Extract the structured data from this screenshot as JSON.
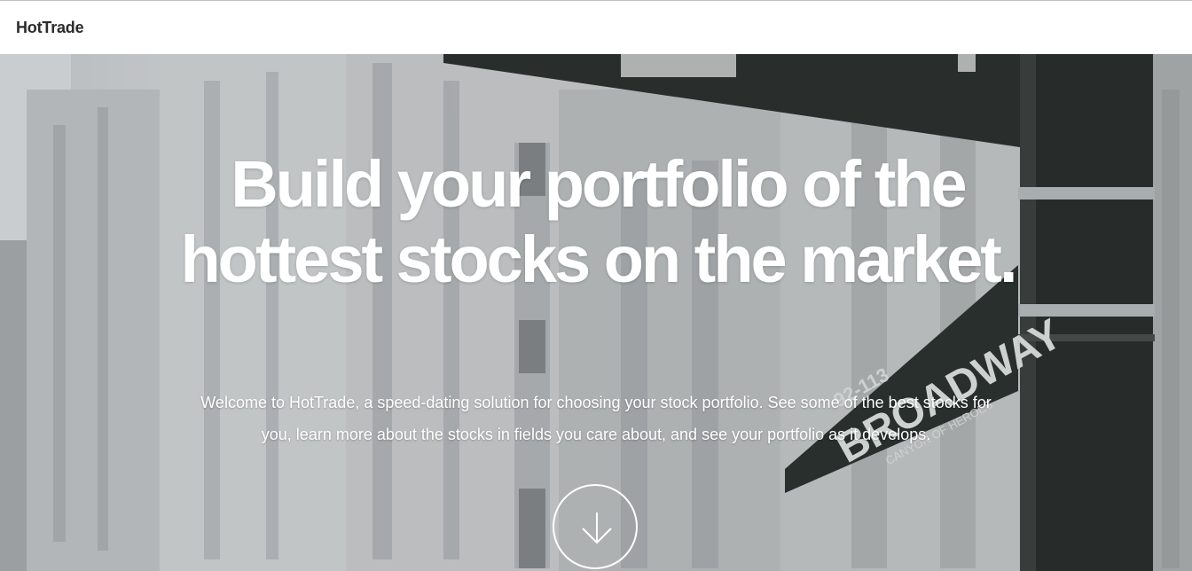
{
  "navbar": {
    "brand": "HotTrade"
  },
  "hero": {
    "headline": "Build your portfolio of the hottest stocks on the market.",
    "description": "Welcome to HotTrade, a speed-dating solution for choosing your stock portfolio. See some of the best stocks for you, learn more about the stocks in fields you care about, and see your portfolio as it develops.",
    "scroll_button_icon": "arrow-down-icon",
    "street_sign_text": "BROADWAY",
    "street_sign_number": "92-113",
    "street_sign_subtext": "CANYON OF HEROES"
  },
  "colors": {
    "navbar_bg": "#ffffff",
    "hero_text": "#ffffff",
    "brand_text": "#2b2b2b"
  }
}
